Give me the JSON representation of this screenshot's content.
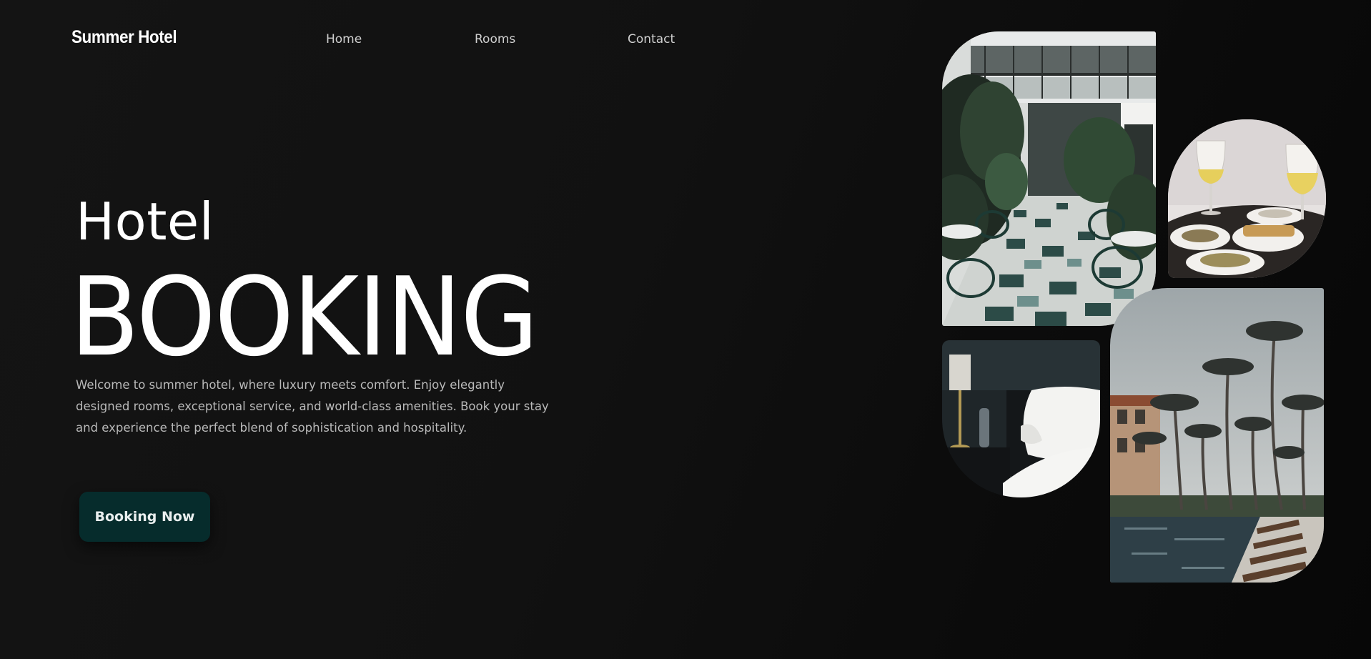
{
  "header": {
    "logo": "Summer Hotel",
    "nav": [
      {
        "label": "Home"
      },
      {
        "label": "Rooms"
      },
      {
        "label": "Contact"
      }
    ]
  },
  "hero": {
    "title_small": "Hotel",
    "title_large": "BOOKING",
    "description": "Welcome to summer hotel, where luxury meets comfort. Enjoy elegantly designed rooms, exceptional service, and world-class amenities. Book your stay and experience the perfect blend of sophistication and hospitality.",
    "cta_label": "Booking Now"
  },
  "gallery": [
    {
      "name": "lobby-courtyard-image"
    },
    {
      "name": "dining-wine-image"
    },
    {
      "name": "bedroom-pillow-image"
    },
    {
      "name": "pool-palm-trees-image"
    }
  ],
  "colors": {
    "background": "#111111",
    "accent": "#062c2c",
    "text": "#ffffff",
    "muted_text": "#b9b9b9"
  }
}
